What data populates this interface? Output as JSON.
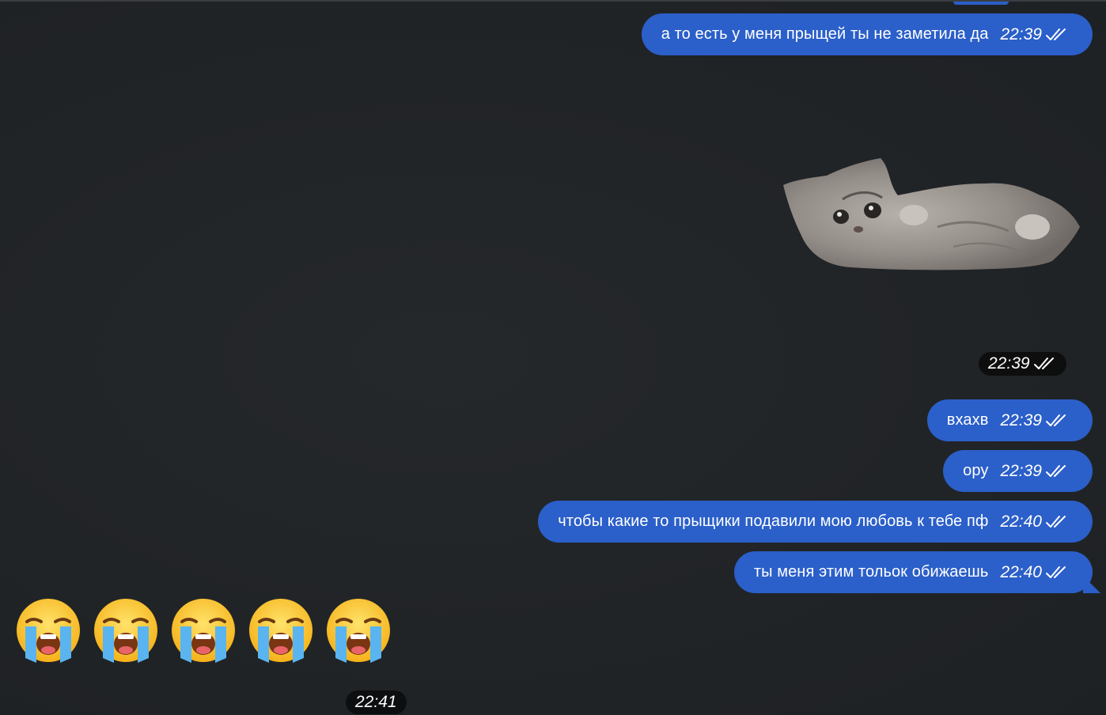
{
  "messages": [
    {
      "text": "а то есть у меня прыщей ты не заметила да",
      "time": "22:39"
    },
    {
      "text": "вхахв",
      "time": "22:39"
    },
    {
      "text": "ору",
      "time": "22:39"
    },
    {
      "text": "чтобы какие то прыщики подавили мою любовь к тебе пф",
      "time": "22:40"
    },
    {
      "text": "ты меня этим тольок обижаешь",
      "time": "22:40"
    }
  ],
  "sticker": {
    "time": "22:39",
    "icon": "kitten-sticker"
  },
  "incoming_emoji": {
    "icon": "loudly-crying-face-emoji",
    "count": 5,
    "time": "22:41"
  },
  "colors": {
    "bubble": "#2b5fc9",
    "background": "#212427"
  }
}
